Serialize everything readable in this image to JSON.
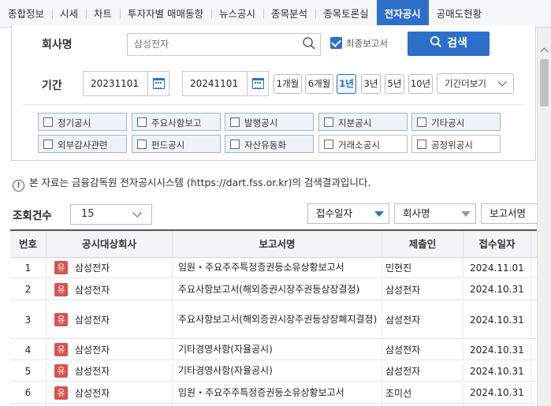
{
  "tabs": [
    "종합정보",
    "시세",
    "차트",
    "투자자별 매매동향",
    "뉴스공시",
    "종목분석",
    "종목토론실",
    "전자공시",
    "공매도현황"
  ],
  "active_tab": 7,
  "search": {
    "company_label": "회사명",
    "company_value": "삼성전자",
    "include_label": "최종보고서",
    "search_button": "검색",
    "period_label": "기간",
    "date_from": "20231101",
    "date_to": "20241101",
    "dash": "-",
    "periods": [
      "1개월",
      "6개월",
      "1년",
      "3년",
      "5년",
      "10년"
    ],
    "selected_period": "1년",
    "more_label": "기간더보기"
  },
  "categories": [
    "정기공시",
    "주요사항보고",
    "발행공시",
    "지분공시",
    "기타공시",
    "외부감사관련",
    "펀드공시",
    "자산유동화",
    "거래소공시",
    "공정위공시"
  ],
  "notice": "본 자료는 금융감독원 전자공시시스템 (https://dart.fss.or.kr)의 검색결과입니다.",
  "notice_icon": "!",
  "count": {
    "label": "조회건수",
    "value": "15"
  },
  "sorts": [
    "접수일자",
    "회사명",
    "보고서명"
  ],
  "table": {
    "headers": [
      "번호",
      "공시대상회사",
      "보고서명",
      "제출인",
      "접수일자",
      "비"
    ],
    "badge": "유",
    "rows": [
      {
        "no": "1",
        "company": "삼성전자",
        "report": "임원・주요주주특정증권등소유상황보고서",
        "submitter": "민현진",
        "date": "2024.11.01"
      },
      {
        "no": "2",
        "company": "삼성전자",
        "report": "주요사항보고서(해외증권시장주권등상장결정)",
        "submitter": "삼성전자",
        "date": "2024.10.31"
      },
      {
        "no": "3",
        "company": "삼성전자",
        "report": "주요사항보고서(해외증권시장주권등상장폐지결정)",
        "submitter": "삼성전자",
        "date": "2024.10.31"
      },
      {
        "no": "4",
        "company": "삼성전자",
        "report": "기타경영사항(자율공시)",
        "submitter": "삼성전자",
        "date": "2024.10.31"
      },
      {
        "no": "5",
        "company": "삼성전자",
        "report": "기타경영사항(자율공시)",
        "submitter": "삼성전자",
        "date": "2024.10.31"
      },
      {
        "no": "6",
        "company": "삼성전자",
        "report": "임원・주요주주특정증권등소유상황보고서",
        "submitter": "조미선",
        "date": "2024.10.31"
      }
    ]
  },
  "colors": {
    "accent": "#2c6fc9",
    "badge": "#d9534f"
  }
}
